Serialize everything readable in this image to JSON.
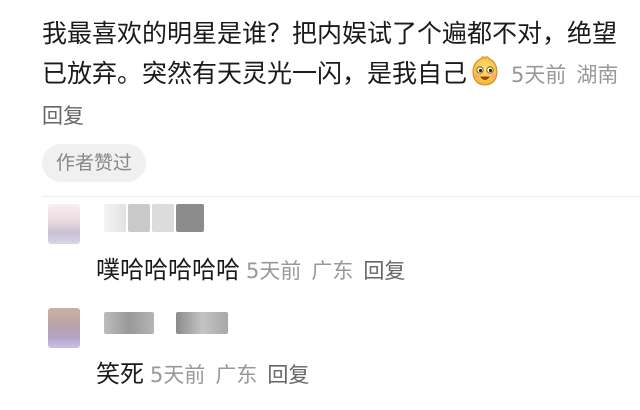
{
  "comment": {
    "text": "我最喜欢的明星是谁？把内娱试了个遍都不对，绝望已放弃。突然有天灵光一闪，是我自己",
    "emoji": "smiling-face-emoji",
    "time": "5天前",
    "location": "湖南",
    "reply_label": "回复",
    "author_liked_badge": "作者赞过"
  },
  "replies": [
    {
      "text": "噗哈哈哈哈哈",
      "time": "5天前",
      "location": "广东",
      "reply_label": "回复"
    },
    {
      "text": "笑死",
      "time": "5天前",
      "location": "广东",
      "reply_label": "回复"
    }
  ],
  "colors": {
    "text": "#1a1a1a",
    "meta": "#999999",
    "badge_bg": "#f0f0f0"
  }
}
